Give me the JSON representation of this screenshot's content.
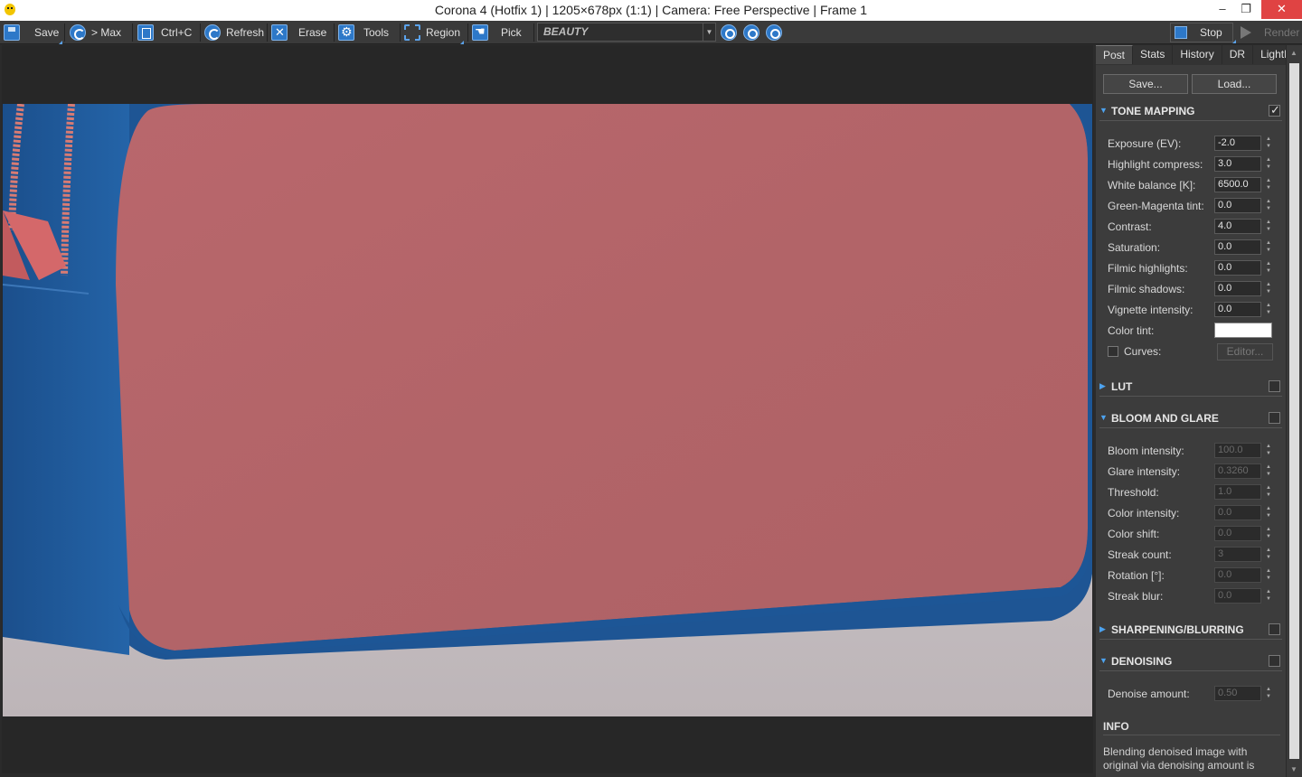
{
  "window": {
    "title": "Corona 4 (Hotfix 1) | 1205×678px (1:1) | Camera: Free Perspective | Frame 1",
    "minimize": "–",
    "maximize": "❐",
    "close": "✕"
  },
  "toolbar": {
    "save": "Save",
    "max": "> Max",
    "copy": "Ctrl+C",
    "refresh": "Refresh",
    "erase": "Erase",
    "tools": "Tools",
    "region": "Region",
    "pick": "Pick",
    "channel": "BEAUTY",
    "stop": "Stop",
    "render": "Render"
  },
  "panel": {
    "tabs": [
      "Post",
      "Stats",
      "History",
      "DR",
      "LightMix"
    ],
    "active_tab": "Post",
    "save_btn": "Save...",
    "load_btn": "Load...",
    "tone_mapping": {
      "title": "TONE MAPPING",
      "enabled": true,
      "rows": [
        {
          "label": "Exposure (EV):",
          "value": "-2.0"
        },
        {
          "label": "Highlight compress:",
          "value": "3.0"
        },
        {
          "label": "White balance [K]:",
          "value": "6500.0"
        },
        {
          "label": "Green-Magenta tint:",
          "value": "0.0"
        },
        {
          "label": "Contrast:",
          "value": "4.0"
        },
        {
          "label": "Saturation:",
          "value": "0.0"
        },
        {
          "label": "Filmic highlights:",
          "value": "0.0"
        },
        {
          "label": "Filmic shadows:",
          "value": "0.0"
        },
        {
          "label": "Vignette intensity:",
          "value": "0.0"
        }
      ],
      "color_tint_label": "Color tint:",
      "color_tint_value": "#ffffff",
      "curves_label": "Curves:",
      "curves_editor": "Editor..."
    },
    "lut": {
      "title": "LUT"
    },
    "bloom": {
      "title": "BLOOM AND GLARE",
      "rows": [
        {
          "label": "Bloom intensity:",
          "value": "100.0"
        },
        {
          "label": "Glare intensity:",
          "value": "0.3260"
        },
        {
          "label": "Threshold:",
          "value": "1.0"
        },
        {
          "label": "Color intensity:",
          "value": "0.0"
        },
        {
          "label": "Color shift:",
          "value": "0.0"
        },
        {
          "label": "Streak count:",
          "value": "3"
        },
        {
          "label": "Rotation [°]:",
          "value": "0.0"
        },
        {
          "label": "Streak blur:",
          "value": "0.0"
        }
      ]
    },
    "sharpening": {
      "title": "SHARPENING/BLURRING"
    },
    "denoising": {
      "title": "DENOISING",
      "amount_label": "Denoise amount:",
      "amount_value": "0.50"
    },
    "info": {
      "title": "INFO",
      "text": "Blending denoised image with original via denoising amount is"
    }
  },
  "colors": {
    "accent": "#2d78c8",
    "bag_blue": "#1f5c9e",
    "bag_red": "#b5676b"
  }
}
